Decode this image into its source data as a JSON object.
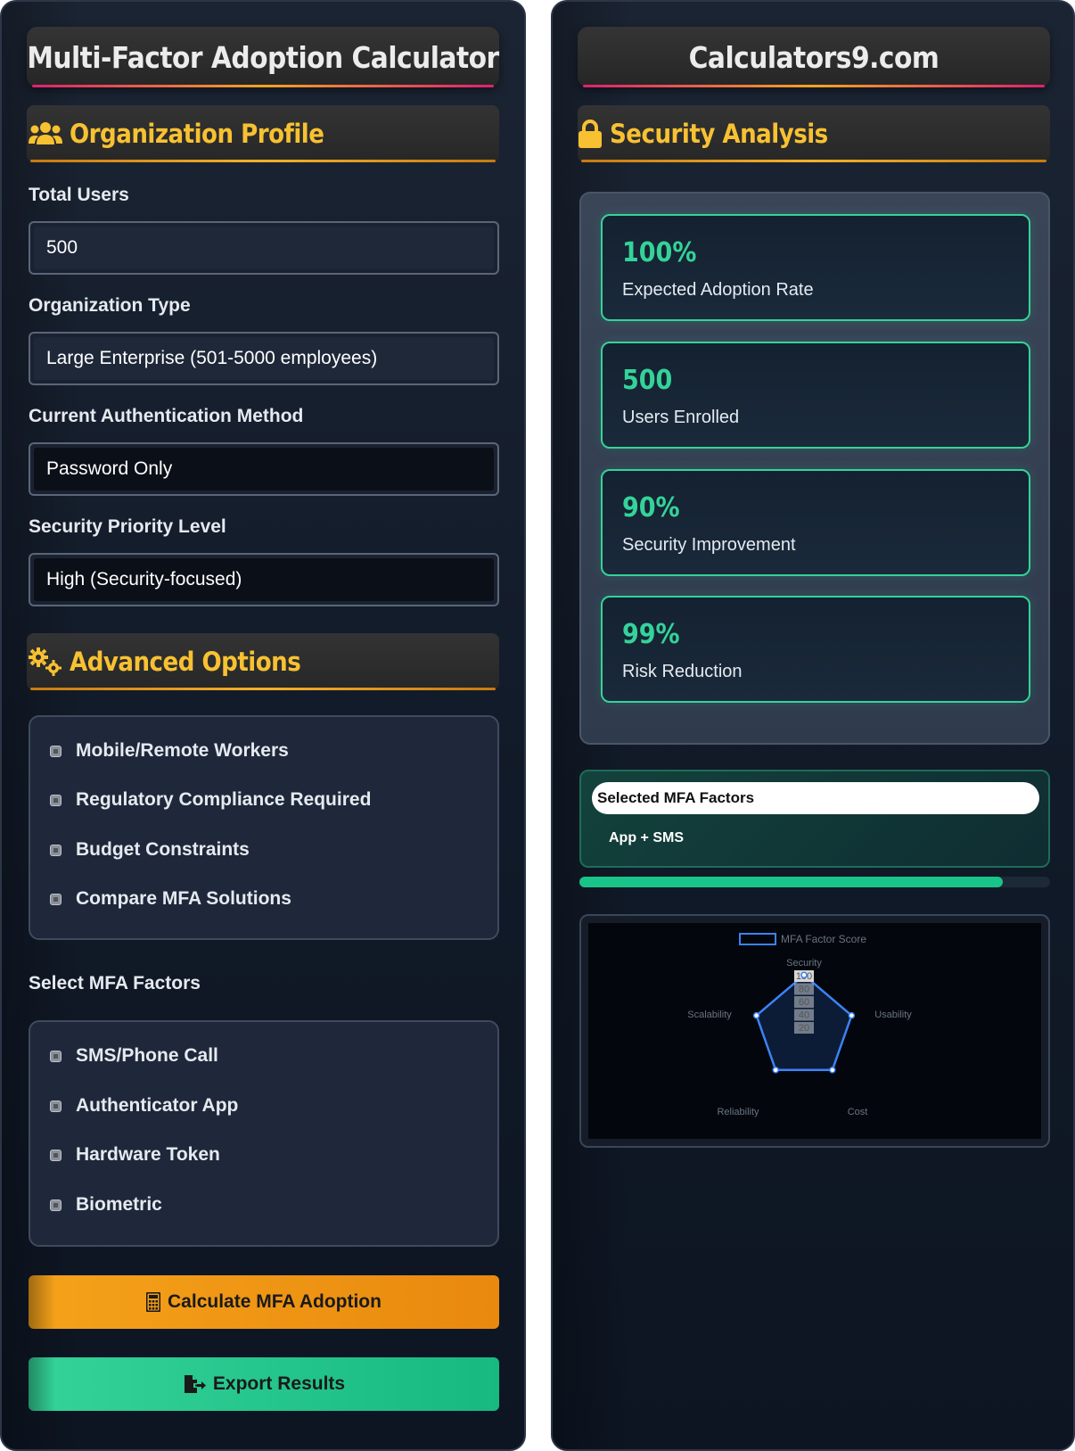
{
  "left": {
    "title": "Multi-Factor Adoption Calculator",
    "org_profile": {
      "heading": "Organization Profile",
      "icon": "users-icon",
      "total_users": {
        "label": "Total Users",
        "value": "500"
      },
      "org_type": {
        "label": "Organization Type",
        "value": "Large Enterprise (501-5000 employees)"
      },
      "auth_method": {
        "label": "Current Authentication Method",
        "value": "Password Only"
      },
      "priority": {
        "label": "Security Priority Level",
        "value": "High (Security-focused)"
      }
    },
    "advanced": {
      "heading": "Advanced Options",
      "icon": "gears-icon",
      "options": [
        {
          "label": "Mobile/Remote Workers",
          "checked": false
        },
        {
          "label": "Regulatory Compliance Required",
          "checked": false
        },
        {
          "label": "Budget Constraints",
          "checked": false
        },
        {
          "label": "Compare MFA Solutions",
          "checked": false
        }
      ]
    },
    "factors": {
      "label": "Select MFA Factors",
      "options": [
        {
          "label": "SMS/Phone Call",
          "checked": false
        },
        {
          "label": "Authenticator App",
          "checked": false
        },
        {
          "label": "Hardware Token",
          "checked": false
        },
        {
          "label": "Biometric",
          "checked": false
        }
      ]
    },
    "buttons": {
      "calculate": "Calculate MFA Adoption",
      "export": "Export Results"
    }
  },
  "right": {
    "title": "Calculators9.com",
    "analysis": {
      "heading": "Security Analysis",
      "icon": "lock-icon",
      "stats": [
        {
          "value": "100%",
          "label": "Expected Adoption Rate"
        },
        {
          "value": "500",
          "label": "Users Enrolled"
        },
        {
          "value": "90%",
          "label": "Security Improvement"
        },
        {
          "value": "99%",
          "label": "Risk Reduction"
        }
      ]
    },
    "selected_factors": {
      "label": "Selected MFA Factors",
      "value": "App + SMS"
    },
    "progress": 0.9
  },
  "colors": {
    "accent_yellow": "#f8c132",
    "accent_green": "#34d399",
    "orange": "#f5a21a",
    "chart_line": "#3b82f6"
  },
  "chart_data": {
    "type": "radar",
    "legend": "MFA Factor Score",
    "axes": [
      "Security",
      "Usability",
      "Cost",
      "Reliability",
      "Scalability"
    ],
    "ticks": [
      "100",
      "80",
      "60",
      "40",
      "20"
    ],
    "range": [
      0,
      100
    ],
    "series": [
      {
        "name": "MFA Factor Score",
        "values": [
          95,
          85,
          82,
          82,
          85
        ]
      }
    ]
  }
}
